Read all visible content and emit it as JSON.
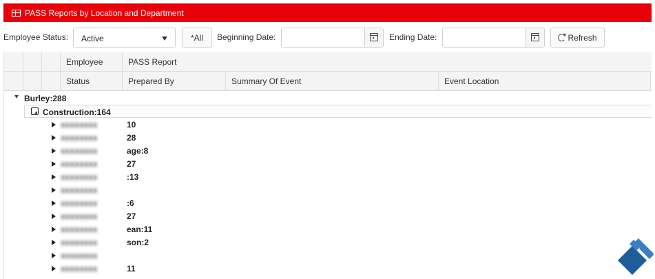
{
  "title": "PASS Reports by Location and Department",
  "filters": {
    "employee_status_label": "Employee Status:",
    "employee_status_value": "Active",
    "all_button_label": "*All",
    "beginning_date_label": "Beginning Date:",
    "beginning_date_value": "",
    "ending_date_label": "Ending Date:",
    "ending_date_value": "",
    "refresh_label": "Refresh"
  },
  "grid": {
    "header_row1": [
      "Employee",
      "PASS Report"
    ],
    "header_row2": [
      "Status",
      "Prepared By",
      "Summary Of Event",
      "Event Location"
    ],
    "location_group": "Burley:288",
    "department_group": "Construction:164",
    "employee_rows": [
      {
        "name": "xxxxxxxx",
        "count_suffix": "10"
      },
      {
        "name": "xxxxxxxx",
        "count_suffix": "28"
      },
      {
        "name": "xxxxxxxx",
        "count_suffix": "age:8"
      },
      {
        "name": "xxxxxxxx",
        "count_suffix": "27"
      },
      {
        "name": "xxxxxxxx",
        "count_suffix": ":13"
      },
      {
        "name": "xxxxxxxx",
        "count_suffix": ""
      },
      {
        "name": "xxxxxxxx",
        "count_suffix": ":6"
      },
      {
        "name": "xxxxxxxx",
        "count_suffix": "27"
      },
      {
        "name": "xxxxxxxx",
        "count_suffix": "ean:11"
      },
      {
        "name": "xxxxxxxx",
        "count_suffix": "son:2"
      },
      {
        "name": "xxxxxxxx",
        "count_suffix": ""
      },
      {
        "name": "xxxxxxxx",
        "count_suffix": "11"
      }
    ]
  },
  "colors": {
    "title_bar": "#e8000a",
    "logo_light": "#3a7fc4",
    "logo_dark": "#1f5d99"
  }
}
